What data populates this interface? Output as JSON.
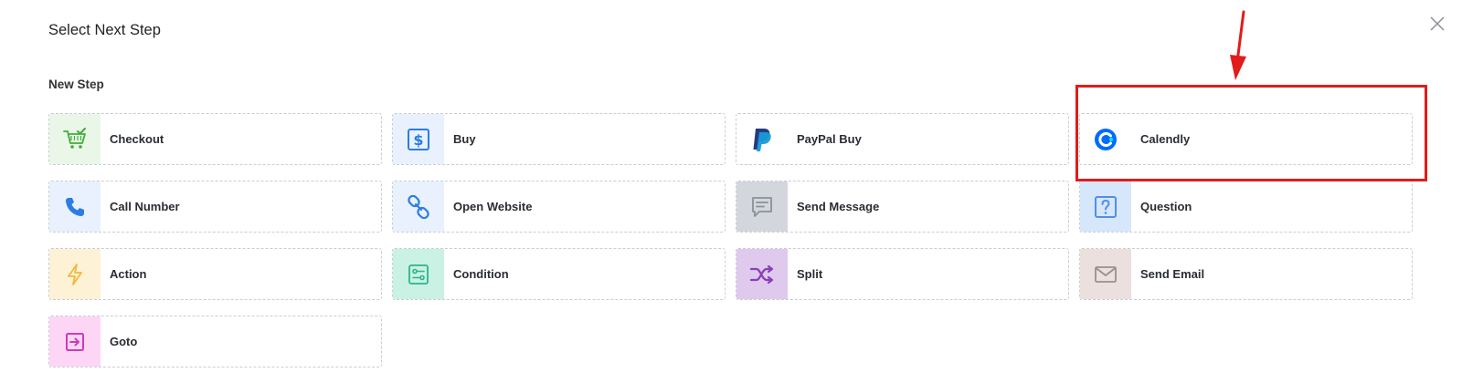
{
  "dialog": {
    "title": "Select Next Step",
    "section_label": "New Step",
    "close_icon": "close-icon"
  },
  "steps": [
    {
      "label": "Checkout",
      "icon": "cart-check-icon",
      "bg": "#eaf7e8",
      "color": "#3fae3a"
    },
    {
      "label": "Buy",
      "icon": "dollar-box-icon",
      "bg": "#e8f1fd",
      "color": "#2b7de1"
    },
    {
      "label": "PayPal Buy",
      "icon": "paypal-icon",
      "bg": "#ffffff",
      "color": "#253b80"
    },
    {
      "label": "Calendly",
      "icon": "calendly-icon",
      "bg": "#ffffff",
      "color": "#006bff"
    },
    {
      "label": "Call Number",
      "icon": "phone-icon",
      "bg": "#e8f1fd",
      "color": "#2b7de1"
    },
    {
      "label": "Open Website",
      "icon": "link-icon",
      "bg": "#e8f1fd",
      "color": "#2b7de1"
    },
    {
      "label": "Send Message",
      "icon": "message-icon",
      "bg": "#d3d6dc",
      "color": "#8a9099"
    },
    {
      "label": "Question",
      "icon": "question-icon",
      "bg": "#d6e6fb",
      "color": "#4f8fe6"
    },
    {
      "label": "Action",
      "icon": "lightning-icon",
      "bg": "#fdf1d6",
      "color": "#f2b83b"
    },
    {
      "label": "Condition",
      "icon": "condition-icon",
      "bg": "#c9f1e4",
      "color": "#2bb58a"
    },
    {
      "label": "Split",
      "icon": "shuffle-icon",
      "bg": "#dfc9ec",
      "color": "#8b3fb8"
    },
    {
      "label": "Send Email",
      "icon": "envelope-icon",
      "bg": "#ece0de",
      "color": "#9a8f8c"
    },
    {
      "label": "Goto",
      "icon": "arrow-in-box-icon",
      "bg": "#fdd6f6",
      "color": "#d03ab8"
    }
  ],
  "annotation": {
    "highlighted_step": "Calendly",
    "color": "#e31b1b"
  }
}
